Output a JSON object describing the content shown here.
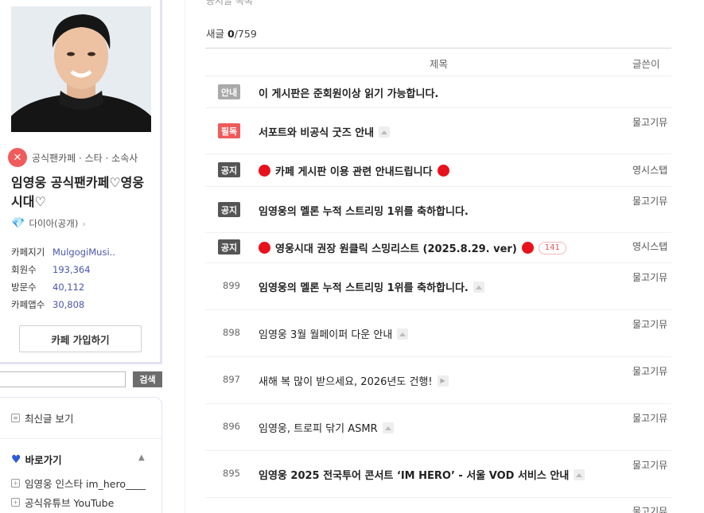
{
  "sidebar": {
    "category_badge": "礿",
    "category": "공식팬카페 · 스타 · 소속사",
    "cafe_name": "임영웅 공식팬카페♡영웅시대♡",
    "grade": "다이아(공개)",
    "stats": [
      {
        "key": "카페지기",
        "value": "MulgogiMusi.."
      },
      {
        "key": "회원수",
        "value": "193,364"
      },
      {
        "key": "방문수",
        "value": "40,112"
      },
      {
        "key": "카페앱수",
        "value": "30,808"
      }
    ],
    "join_label": "카페 가입하기",
    "search_button": "검색",
    "recent_label": "최신글 보기",
    "shortcut_label": "바로가기",
    "links": [
      "임영웅 인스타 im_hero____",
      "공식유튜브 YouTube"
    ]
  },
  "board": {
    "crumb": "공지글 목록",
    "new_label": "새글",
    "new_count": "0",
    "total": "/759",
    "col_title": "제목",
    "col_author": "글쓴이",
    "rows": [
      {
        "badge": "안내",
        "title": "이 게시판은 준회원이상 읽기 가능합니다.",
        "author": ""
      },
      {
        "badge": "필독",
        "title": "서포트와 비공식 굿즈 안내",
        "author": "물고기뮤 l"
      },
      {
        "badge": "공지",
        "title": "카페 게시판 이용 관련 안내드립니다",
        "author": "영시스탭"
      },
      {
        "badge": "공지",
        "title": "임영웅의 멜론 누적 스트리밍 1위를 축하합니다.",
        "author": "물고기뮤 l"
      },
      {
        "badge": "공지",
        "title": "영웅시대 권장 원클릭 스밍리스트 (2025.8.29. ver)",
        "comments": "141",
        "author": "영시스탭"
      },
      {
        "num": "899",
        "title": "임영웅의 멜론 누적 스트리밍 1위를 축하합니다.",
        "author": "물고기뮤 l"
      },
      {
        "num": "898",
        "title": "임영웅 3월 월페이퍼 다운 안내",
        "author": "물고기뮤 l"
      },
      {
        "num": "897",
        "title": "새해 복 많이 받으세요, 2026년도 건행!",
        "author": "물고기뮤 l"
      },
      {
        "num": "896",
        "title": "임영웅, 트로피 닦기 ASMR",
        "author": "물고기뮤 l"
      },
      {
        "num": "895",
        "title": "임영웅 2025 전국투어 콘서트 ‘IM HERO’ - 서울 VOD 서비스 안내",
        "author": "물고기뮤 l"
      },
      {
        "num": "",
        "title": "",
        "author": "물고기뮤"
      }
    ]
  },
  "colors": {
    "accent": "#4a55b0",
    "must": "#f05a5a",
    "notice": "#555555",
    "red_dot": "#e8111b"
  }
}
